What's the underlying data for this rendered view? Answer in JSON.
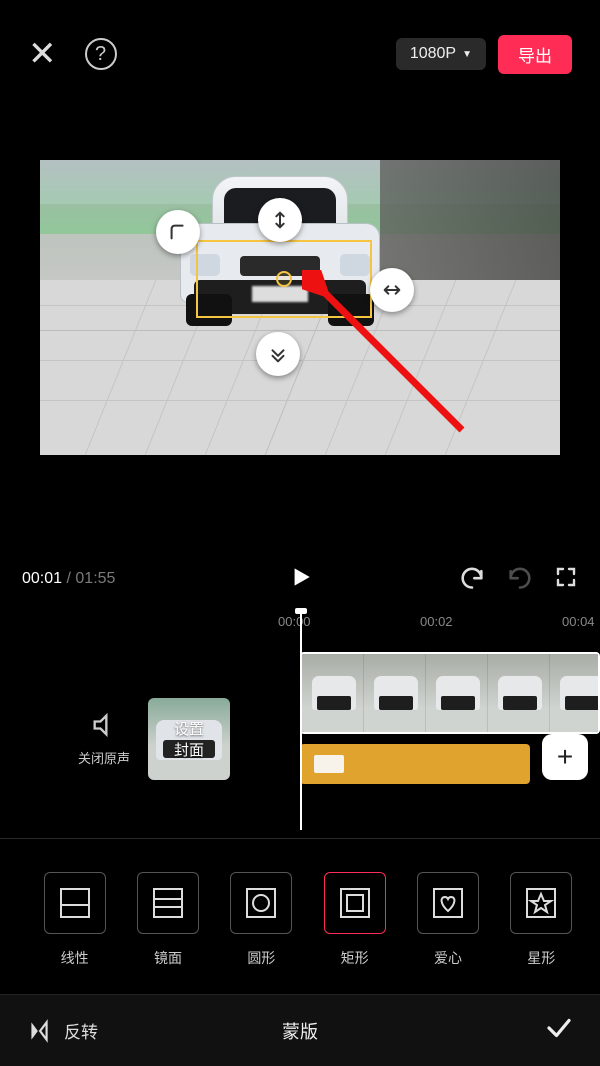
{
  "header": {
    "resolution_label": "1080P",
    "export_label": "导出"
  },
  "playback": {
    "current_time": "00:01",
    "total_time": "01:55"
  },
  "ruler": {
    "t0": "00:00",
    "t1": "00:02",
    "t2": "00:04"
  },
  "timeline": {
    "mute_label": "关闭原声",
    "cover_label": "设置\n封面"
  },
  "mask_shapes": [
    {
      "key": "linear",
      "label": "线性"
    },
    {
      "key": "mirror",
      "label": "镜面"
    },
    {
      "key": "circle",
      "label": "圆形"
    },
    {
      "key": "rect",
      "label": "矩形"
    },
    {
      "key": "heart",
      "label": "爱心"
    },
    {
      "key": "star",
      "label": "星形"
    }
  ],
  "bottom": {
    "invert_label": "反转",
    "title": "蒙版"
  }
}
